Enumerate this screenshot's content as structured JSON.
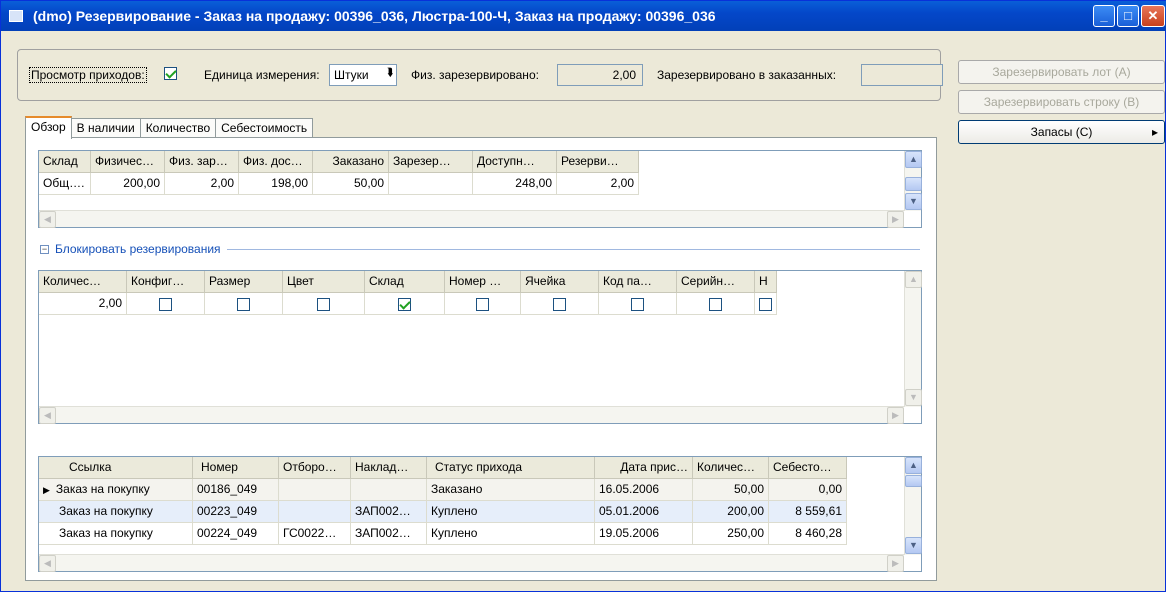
{
  "window": {
    "title": "(dmo) Резервирование - Заказ на продажу: 00396_036, Люстра-100-Ч, Заказ на продажу: 00396_036"
  },
  "top": {
    "view_receipts_label": "Просмотр приходов:",
    "view_receipts_checked": true,
    "unit_label": "Единица измерения:",
    "unit_value": "Штуки",
    "phys_reserved_label": "Физ. зарезервировано:",
    "phys_reserved_value": "2,00",
    "reserved_ordered_label": "Зарезервировано в заказанных:",
    "reserved_ordered_value": ""
  },
  "buttons": {
    "reserve_lot": "Зарезервировать лот (A)",
    "reserve_line": "Зарезервировать строку (B)",
    "inventory": "Запасы (C)"
  },
  "tabs": [
    "Обзор",
    "В наличии",
    "Количество",
    "Себестоимость"
  ],
  "grid1": {
    "headers": [
      "Склад",
      "Физичес…",
      "Физ. зар…",
      "Физ. дос…",
      "Заказано",
      "Зарезер…",
      "Доступн…",
      "Резерви…"
    ],
    "rows": [
      [
        "Общ….",
        "200,00",
        "2,00",
        "198,00",
        "50,00",
        "",
        "248,00",
        "2,00"
      ]
    ]
  },
  "block_group": {
    "label": "Блокировать резервирования"
  },
  "grid2": {
    "headers": [
      "Количес…",
      "Конфиг…",
      "Размер",
      "Цвет",
      "Склад",
      "Номер …",
      "Ячейка",
      "Код па…",
      "Серийн…",
      "Н"
    ],
    "row": {
      "qty": "2,00",
      "checks": [
        false,
        false,
        false,
        true,
        false,
        false,
        false,
        false,
        false
      ]
    }
  },
  "grid3": {
    "headers": [
      "Ссылка",
      "Номер",
      "Отборо…",
      "Наклад…",
      "Статус прихода",
      "Дата прис…",
      "Количес…",
      "Себесто…"
    ],
    "rows": [
      [
        "Заказ на покупку",
        "00186_049",
        "",
        "",
        "Заказано",
        "16.05.2006",
        "50,00",
        "0,00"
      ],
      [
        "Заказ на покупку",
        "00223_049",
        "",
        "ЗАП002…",
        "Куплено",
        "05.01.2006",
        "200,00",
        "8 559,61"
      ],
      [
        "Заказ на покупку",
        "00224_049",
        "ГС0022…",
        "ЗАП002…",
        "Куплено",
        "19.05.2006",
        "250,00",
        "8 460,28"
      ]
    ]
  }
}
